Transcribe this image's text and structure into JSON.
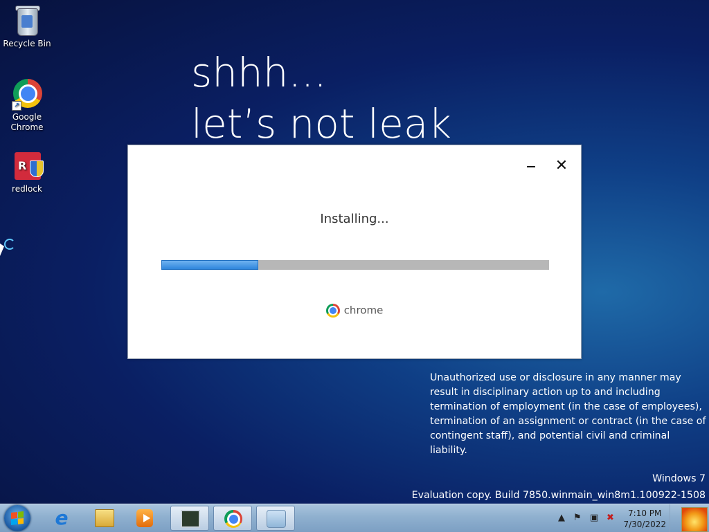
{
  "desktop": {
    "icons": [
      {
        "label": "Recycle Bin",
        "icon": "recycle-bin-icon"
      },
      {
        "label": "Google Chrome",
        "icon": "chrome-icon"
      },
      {
        "label": "redlock",
        "icon": "redlock-icon"
      }
    ],
    "wallpaper_text": {
      "line1": "shhh...",
      "line2": "let’s not leak"
    },
    "legal_notice": "Unauthorized use or disclosure in any manner may result in disciplinary action up to and including termination of employment (in the case of employees), termination of an assignment or contract (in the case of contingent staff), and potential civil and criminal liability.",
    "watermark": {
      "os": "Windows 7",
      "build": "Evaluation copy. Build 7850.winmain_win8m1.100922-1508"
    }
  },
  "installer": {
    "status": "Installing...",
    "progress_fraction": 0.25,
    "brand": "chrome",
    "minimize_symbol": "−",
    "close_symbol": "✕"
  },
  "taskbar": {
    "items": [
      {
        "icon": "internet-explorer-icon",
        "active": false
      },
      {
        "icon": "file-explorer-icon",
        "active": false
      },
      {
        "icon": "media-player-icon",
        "active": false
      },
      {
        "icon": "task-manager-icon",
        "active": true
      },
      {
        "icon": "chrome-icon",
        "active": true
      },
      {
        "icon": "installer-icon",
        "active": true
      }
    ],
    "tray": {
      "show_hidden": "▲",
      "flag": "⚑",
      "network": "▣",
      "volume": "✖"
    },
    "clock": {
      "time": "7:10 PM",
      "date": "7/30/2022"
    }
  },
  "colors": {
    "progress": "#2f86dc",
    "chrome_red": "#db4437",
    "chrome_yellow": "#f4c20d",
    "chrome_green": "#0f9d58",
    "chrome_blue": "#4285f4"
  }
}
